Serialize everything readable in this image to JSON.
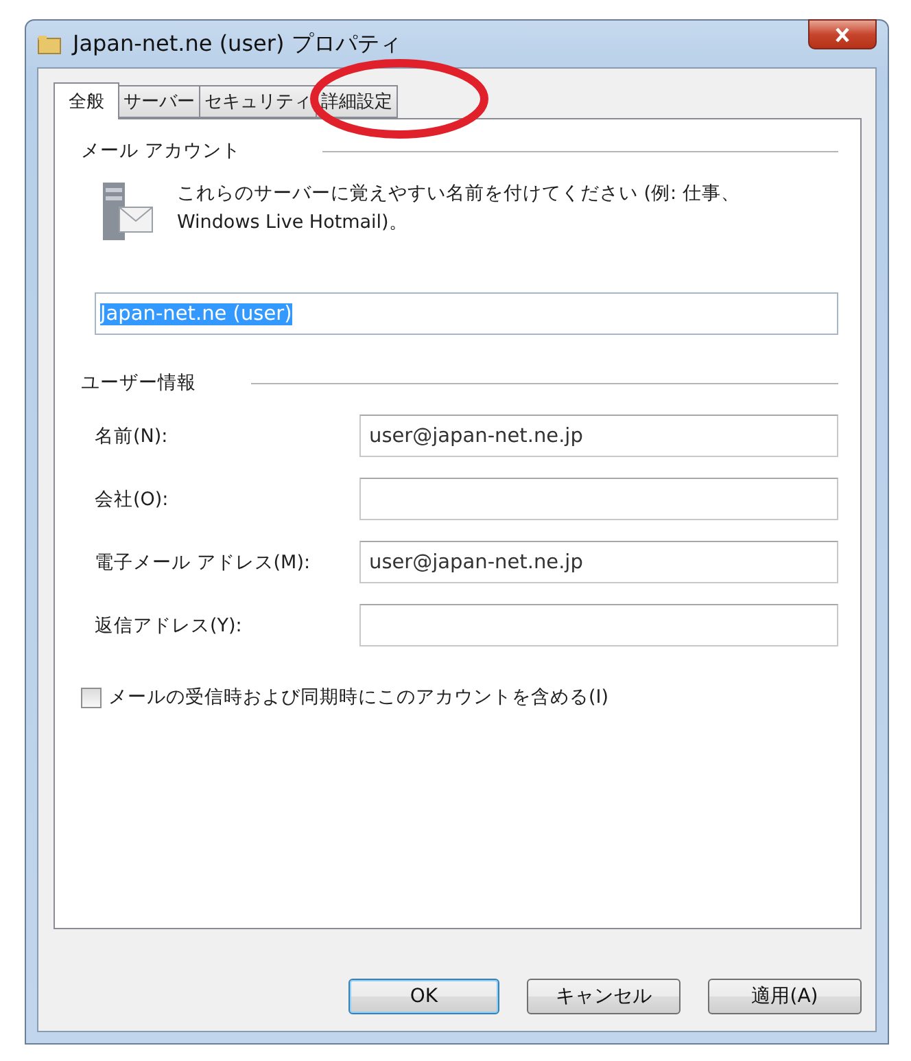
{
  "window": {
    "title": "Japan-net.ne (user) プロパティ"
  },
  "tabs": [
    {
      "label": "全般",
      "selected": true
    },
    {
      "label": "サーバー",
      "selected": false
    },
    {
      "label": "セキュリティ",
      "selected": false
    },
    {
      "label": "詳細設定",
      "selected": false,
      "circled": true
    }
  ],
  "mail_account": {
    "heading": "メール アカウント",
    "description": "これらのサーバーに覚えやすい名前を付けてください (例: 仕事、Windows Live Hotmail)。",
    "value": "Japan-net.ne (user)"
  },
  "user_info": {
    "heading": "ユーザー情報",
    "fields": [
      {
        "label": "名前(N):",
        "value": "user@japan-net.ne.jp"
      },
      {
        "label": "会社(O):"
      },
      {
        "label": "電子メール アドレス(M):",
        "value": "user@japan-net.ne.jp"
      },
      {
        "label": "返信アドレス(Y):"
      }
    ]
  },
  "include_account": {
    "label": "メールの受信時および同期時にこのアカウントを含める(I)",
    "checked": false
  },
  "buttons": [
    {
      "label": "OK",
      "default": true
    },
    {
      "label": "キャンセル",
      "default": false
    },
    {
      "label": "適用(A)",
      "default": false
    }
  ]
}
